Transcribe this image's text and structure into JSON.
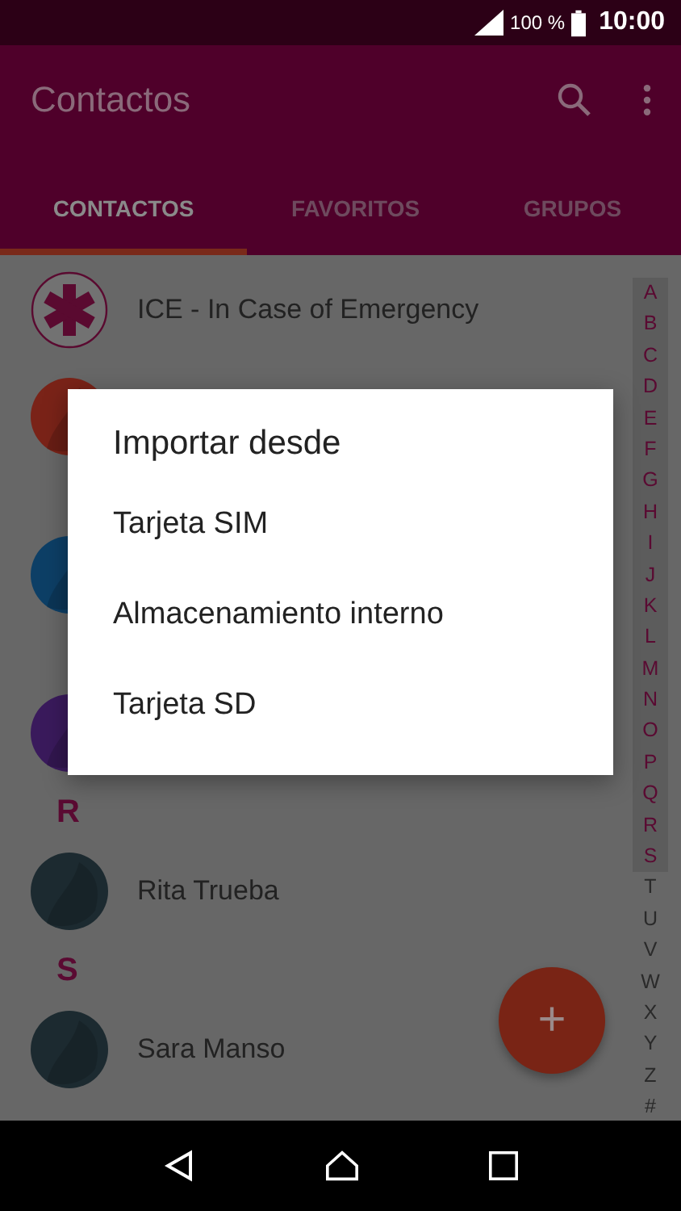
{
  "status_bar": {
    "battery": "100 %",
    "time": "10:00"
  },
  "app_bar": {
    "title": "Contactos"
  },
  "tabs": [
    {
      "label": "CONTACTOS",
      "selected": true
    },
    {
      "label": "FAVORITOS",
      "selected": false
    },
    {
      "label": "GRUPOS",
      "selected": false
    }
  ],
  "contacts": [
    {
      "kind": "ice",
      "name": "ICE - In Case of Emergency",
      "color": "#5a0a30"
    },
    {
      "kind": "contact",
      "color": "#7a2318"
    },
    {
      "kind": "spacer"
    },
    {
      "kind": "contact",
      "color": "#0d3f66"
    },
    {
      "kind": "spacer"
    },
    {
      "kind": "contact",
      "color": "#3a1a5c"
    },
    {
      "kind": "header",
      "letter": "R"
    },
    {
      "kind": "contact",
      "name": "Rita Trueba",
      "color": "#1c2a30"
    },
    {
      "kind": "header",
      "letter": "S"
    },
    {
      "kind": "contact",
      "name": "Sara Manso",
      "color": "#1c2a30"
    }
  ],
  "alphabet": [
    {
      "letter": "A",
      "highlighted": true
    },
    {
      "letter": "B",
      "highlighted": true
    },
    {
      "letter": "C",
      "highlighted": true
    },
    {
      "letter": "D",
      "highlighted": true
    },
    {
      "letter": "E",
      "highlighted": true
    },
    {
      "letter": "F",
      "highlighted": true
    },
    {
      "letter": "G",
      "highlighted": true
    },
    {
      "letter": "H",
      "highlighted": true
    },
    {
      "letter": "I",
      "highlighted": true
    },
    {
      "letter": "J",
      "highlighted": true
    },
    {
      "letter": "K",
      "highlighted": true
    },
    {
      "letter": "L",
      "highlighted": true
    },
    {
      "letter": "M",
      "highlighted": true
    },
    {
      "letter": "N",
      "highlighted": true
    },
    {
      "letter": "O",
      "highlighted": true
    },
    {
      "letter": "P",
      "highlighted": true
    },
    {
      "letter": "Q",
      "highlighted": true
    },
    {
      "letter": "R",
      "highlighted": true
    },
    {
      "letter": "S",
      "highlighted": true
    },
    {
      "letter": "T",
      "highlighted": false
    },
    {
      "letter": "U",
      "highlighted": false
    },
    {
      "letter": "V",
      "highlighted": false
    },
    {
      "letter": "W",
      "highlighted": false
    },
    {
      "letter": "X",
      "highlighted": false
    },
    {
      "letter": "Y",
      "highlighted": false
    },
    {
      "letter": "Z",
      "highlighted": false
    },
    {
      "letter": "#",
      "highlighted": false
    }
  ],
  "fab": {
    "label": "+"
  },
  "dialog": {
    "title": "Importar desde",
    "options": [
      "Tarjeta SIM",
      "Almacenamiento interno",
      "Tarjeta SD"
    ]
  }
}
